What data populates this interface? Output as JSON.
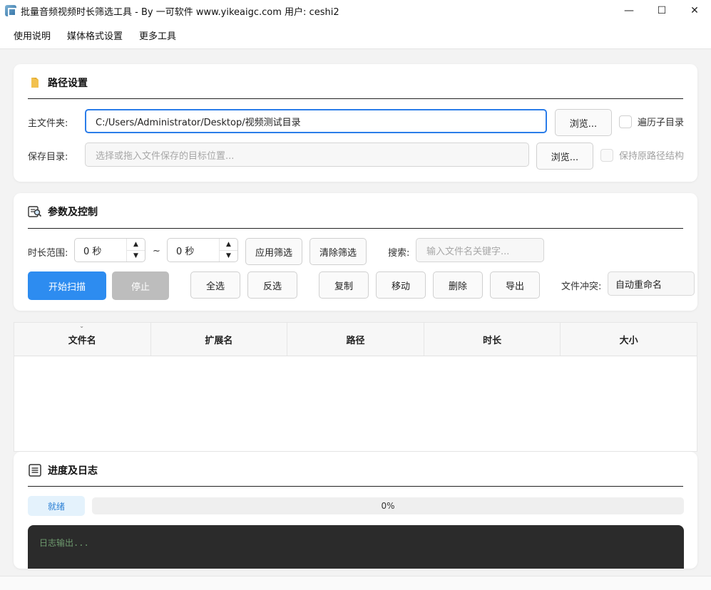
{
  "window": {
    "title": "批量音频视频时长筛选工具 - By 一可软件 www.yikeaigc.com 用户: ceshi2",
    "minimize": "—",
    "maximize": "☐",
    "close": "✕"
  },
  "menu": [
    "使用说明",
    "媒体格式设置",
    "更多工具"
  ],
  "path_settings": {
    "title": "路径设置",
    "main_folder_label": "主文件夹:",
    "main_folder_value": "C:/Users/Administrator/Desktop/视频测试目录",
    "browse_label": "浏览...",
    "recurse_label": "遍历子目录",
    "save_dir_label": "保存目录:",
    "save_dir_placeholder": "选择或拖入文件保存的目标位置...",
    "save_browse_label": "浏览...",
    "keep_structure_label": "保持原路径结构"
  },
  "params": {
    "title": "参数及控制",
    "duration_label": "时长范围:",
    "min_value": "0 秒",
    "tilde": "~",
    "max_value": "0 秒",
    "apply_filter": "应用筛选",
    "clear_filter": "清除筛选",
    "search_label": "搜索:",
    "search_placeholder": "输入文件名关键字...",
    "start_scan": "开始扫描",
    "stop": "停止",
    "select_all": "全选",
    "invert": "反选",
    "copy": "复制",
    "move": "移动",
    "delete": "删除",
    "export": "导出",
    "conflict_label": "文件冲突:",
    "conflict_value": "自动重命名"
  },
  "table": {
    "columns": [
      "文件名",
      "扩展名",
      "路径",
      "时长",
      "大小"
    ],
    "rows": []
  },
  "progress": {
    "title": "进度及日志",
    "status": "就绪",
    "percent_text": "0%",
    "percent": 0,
    "log_placeholder": "日志输出..."
  },
  "colors": {
    "accent": "#2d8cf0",
    "disabled": "#bdbdbd",
    "log_bg": "#2b2b2b"
  }
}
